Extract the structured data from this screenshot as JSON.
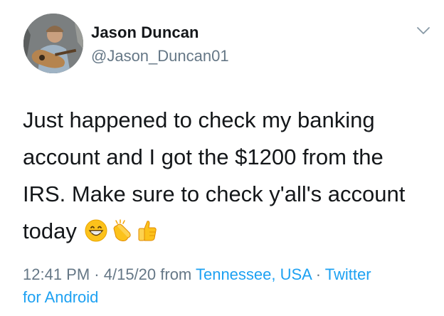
{
  "author": {
    "name": "Jason Duncan",
    "handle": "@Jason_Duncan01"
  },
  "tweet": {
    "lines": [
      "Just happened to check my banking",
      "account and I got the $1200 from the",
      "IRS. Make sure to check y'all's account",
      "today"
    ],
    "emojis": [
      "grinning-face-emoji",
      "clapping-hands-emoji",
      "thumbs-up-emoji"
    ]
  },
  "meta": {
    "time": "12:41 PM",
    "sep1": " · ",
    "date": "4/15/20",
    "from_label": " from ",
    "location": "Tennessee, USA",
    "sep2": " · ",
    "source_line1": "Twitter",
    "source_line2": "for Android"
  },
  "colors": {
    "text": "#14171a",
    "secondary": "#657786",
    "link": "#1da1f2"
  }
}
